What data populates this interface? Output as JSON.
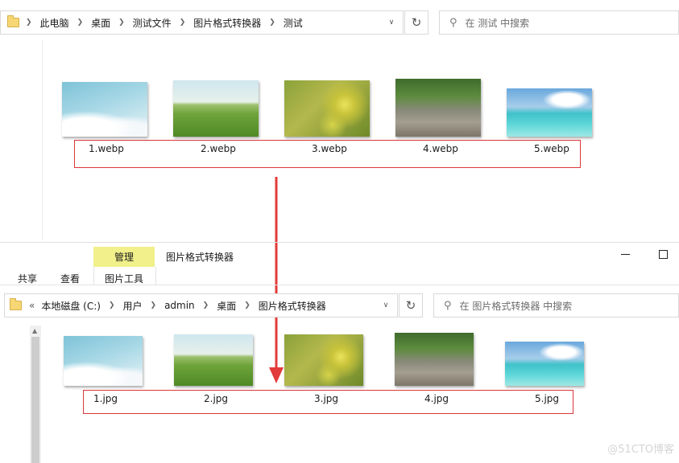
{
  "top_window": {
    "breadcrumbs": [
      "此电脑",
      "桌面",
      "测试文件",
      "图片格式转换器",
      "测试"
    ],
    "search_placeholder": "在 测试 中搜索",
    "files": [
      "1.webp",
      "2.webp",
      "3.webp",
      "4.webp",
      "5.webp"
    ]
  },
  "bottom_window": {
    "title": "图片格式转换器",
    "ribbon": {
      "manage_label": "管理",
      "tabs": [
        "共享",
        "查看"
      ],
      "tools_label": "图片工具"
    },
    "breadcrumb_overflow": "«",
    "breadcrumbs": [
      "本地磁盘 (C:)",
      "用户",
      "admin",
      "桌面",
      "图片格式转换器"
    ],
    "search_placeholder": "在 图片格式转换器 中搜索",
    "files": [
      "1.jpg",
      "2.jpg",
      "3.jpg",
      "4.jpg",
      "5.jpg"
    ]
  },
  "watermark": "@51CTO博客",
  "colors": {
    "annotation_red": "#e33b3b",
    "manage_tab_bg": "#f1f08a"
  },
  "icons": {
    "folder": "folder-icon",
    "refresh": "refresh-icon",
    "search": "search-icon",
    "chevron": "chevron-down-icon",
    "minimize": "minimize-icon",
    "maximize": "maximize-icon"
  }
}
